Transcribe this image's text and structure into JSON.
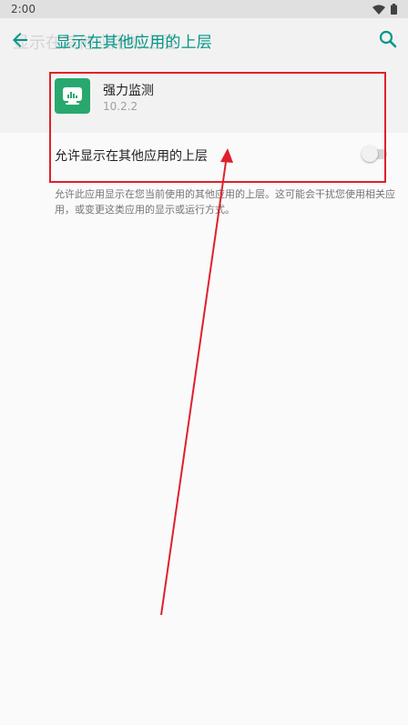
{
  "status_bar": {
    "time": "2:00",
    "icons": [
      "wifi-icon",
      "battery-icon"
    ]
  },
  "toolbar": {
    "ghost_title": "显示在其他应用的上层",
    "title": "显示在其他应用的上层",
    "back_icon": "arrow-back-icon",
    "search_icon": "search-icon"
  },
  "app": {
    "name": "强力监测",
    "version": "10.2.2",
    "icon": "monitor-chart-icon"
  },
  "setting": {
    "label": "允许显示在其他应用的上层",
    "enabled": false
  },
  "description": "允许此应用显示在您当前使用的其他应用的上层。这可能会干扰您使用相关应用，或变更这类应用的显示或运行方式。",
  "colors": {
    "accent": "#009688",
    "app_icon_bg": "#29a86e",
    "annotation": "#e0202b"
  }
}
